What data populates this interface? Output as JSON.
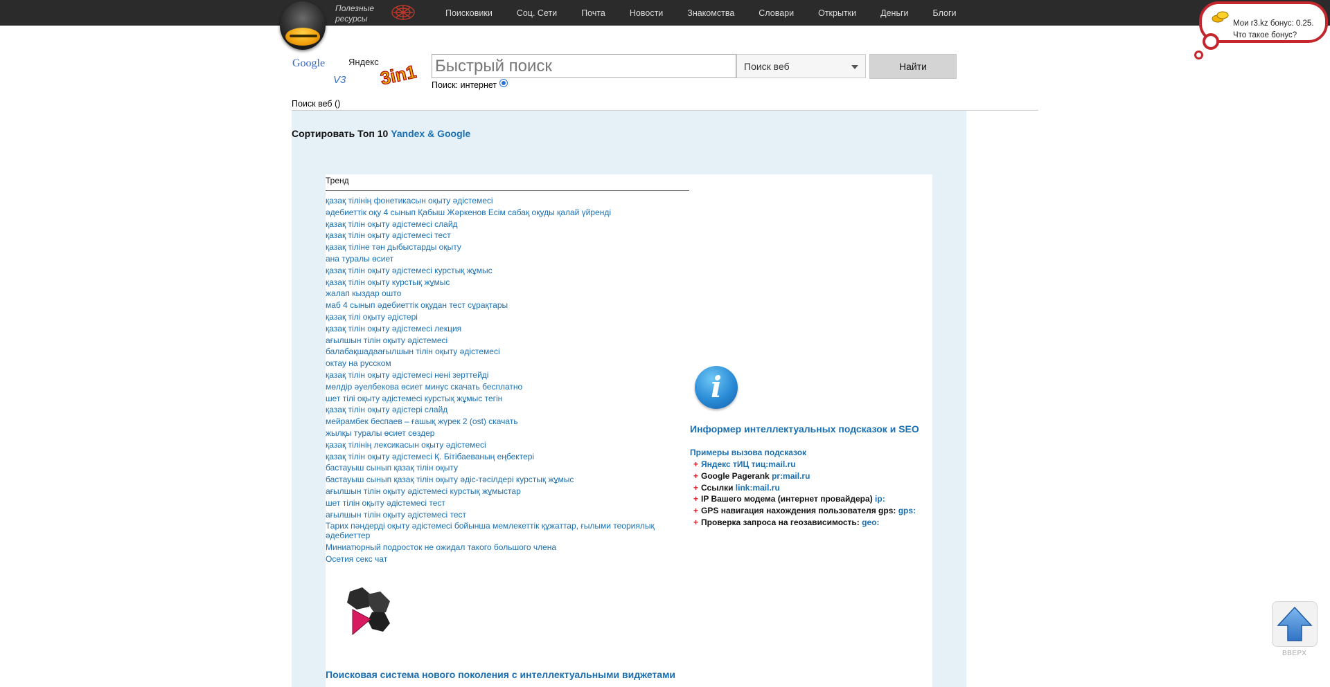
{
  "topbar": {
    "useful_line1": "Полезные",
    "useful_line2": "ресурсы",
    "nav": [
      "Поисковики",
      "Соц. Сети",
      "Почта",
      "Новости",
      "Знакомства",
      "Словари",
      "Открытки",
      "Деньги",
      "Блоги"
    ]
  },
  "bonus": {
    "line1": "Мои r3.kz бонус: 0.25.",
    "line2": "Что такое бонус?"
  },
  "search": {
    "logo_google": "Google",
    "logo_yandex": "Яндекс",
    "logo_3in1": "3in1",
    "placeholder": "Быстрый поиск",
    "engine_selected": "Поиск веб",
    "find_button": "Найти",
    "scope_label": "Поиск: интернет"
  },
  "results": {
    "web_label": "Поиск веб ()",
    "sort_prefix": "Сортировать Топ 10",
    "sort_engines": "Yandex & Google",
    "trend_title": "Тренд",
    "trend_links": [
      "қазақ тілінің фонетикасын оқыту әдістемесі",
      "әдебиеттік оқу 4 сынып Қабыш Жәркенов Есім сабақ оқуды қалай үйренді",
      "қазақ тілін оқыту әдістемесі слайд",
      "қазақ тілін оқыту әдістемесі тест",
      "қазақ тіліне тән дыбыстарды оқыту",
      "ана туралы өсиет",
      "қазақ тілін оқыту әдістемесі курстық жұмыс",
      "қазақ тілін оқыту курстық жұмыс",
      "жалап кыздар ошто",
      "маб 4 сынып әдебиеттік оқудан тест сұрақтары",
      "қазақ тілі оқыту әдістері",
      "қазақ тілін оқыту әдістемесі лекция",
      "ағылшын тілін оқыту әдістемесі",
      "балабақшадаағылшын тілін оқыту әдістемесі",
      "октау на русском",
      "қазақ тілін оқыту әдістемесі нені зерттейді",
      "мөлдір әуелбекова өсиет минус скачать бесплатно",
      "шет тілі оқыту әдістемесі курстық жұмыс тегін",
      "қазақ тілін оқыту әдістері слайд",
      "мейрамбек беспаев – ғашық жүрек 2 (ost) скачать",
      "жылқы туралы өсиет сөздер",
      "қазақ тілінің лексикасын оқыту әдістемесі",
      "қазақ тілін оқыту әдістемесі Қ. Бітібаеваның еңбектері",
      "бастауыш сынып қазақ тілін оқыту",
      "бастауыш сынып қазақ тілін оқыту әдіс-тәсілдері курстық жұмыс",
      "ағылшын тілін оқыту әдістемесі курстық жұмыстар",
      "шет тілін оқыту әдістемесі тест",
      "ағылшын тілін оқыту әдістемесі тест",
      "Тарих пәндерді оқыту әдістемесі бойынша мемлекеттік құжаттар, ғылыми теориялық әдебиеттер",
      "Миниатюрный подросток не ожидал такого большого члена",
      "Осетия секс чат"
    ],
    "widget_title": "Поисковая система нового поколения с интеллектуальными виджетами"
  },
  "informer": {
    "icon_letter": "i",
    "title": "Информер интеллектуальных подсказок и SEO",
    "examples_title": "Примеры вызова подсказок",
    "rows": [
      {
        "plus": "+",
        "label": "Яндекс тИЦ тиц:mail.ru",
        "code": ""
      },
      {
        "plus": "+",
        "label": "Google Pagerank",
        "code": "pr:mail.ru"
      },
      {
        "plus": "+",
        "label": "Ссылки",
        "code": "link:mail.ru"
      },
      {
        "plus": "+",
        "label": "IP Вашего модема (интернет провайдера)",
        "code": "ip:"
      },
      {
        "plus": "+",
        "label": "GPS навигация нахождения пользователя gps:",
        "code": "gps:"
      },
      {
        "plus": "+",
        "label": "Проверка запроса на геозависимость:",
        "code": "geo:"
      }
    ]
  },
  "up_button": {
    "label": "ВВЕРХ"
  },
  "colors": {
    "link": "#1a6fb2",
    "topbar": "#2b2b2b",
    "panel": "#e5f0f7",
    "bubble_border": "#c4262e"
  }
}
